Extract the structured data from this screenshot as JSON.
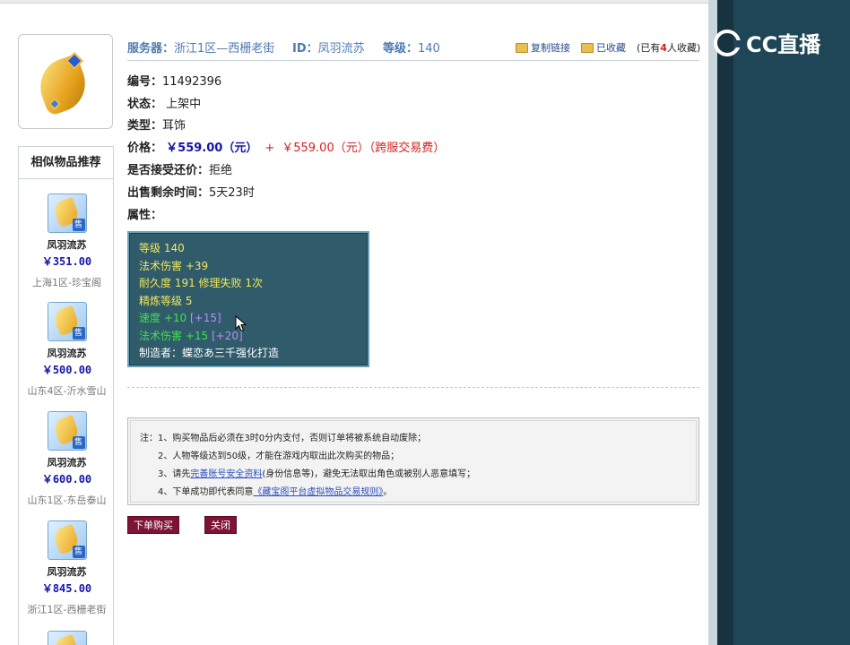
{
  "watermark": {
    "logo_text": "CC直播"
  },
  "header": {
    "server_label": "服务器：",
    "server_value": "浙江1区—西栅老街",
    "id_label": "ID：",
    "id_value": "凤羽流苏",
    "level_label": "等级：",
    "level_value": "140",
    "copy_link": "复制链接",
    "favorited": "已收藏",
    "fav_prefix": "(已有",
    "fav_count": "4",
    "fav_suffix": "人收藏)"
  },
  "item": {
    "number_label": "编号：",
    "number_value": "11492396",
    "status_label": "状态：",
    "status_value": "上架中",
    "type_label": "类型：",
    "type_value": "耳饰",
    "price_label": "价格：",
    "price_value": "￥559.00（元）",
    "price_plus": "+",
    "fee_value": "￥559.00（元）（跨服交易费）",
    "bargain_label": "是否接受还价：",
    "bargain_value": "拒绝",
    "time_label": "出售剩余时间：",
    "time_value": "5天23时",
    "attr_label": "属性："
  },
  "attributes": {
    "line1": "等级 140",
    "line2": "法术伤害 +39",
    "line3": "耐久度 191 修理失败 1次",
    "line4": "精炼等级 5",
    "line5_main": "速度 +10",
    "line5_extra": "[+15]",
    "line6_main": "法术伤害 +15",
    "line6_extra": "[+20]",
    "line7": "制造者：蝶恋あ三千强化打造"
  },
  "sidebar": {
    "title": "相似物品推荐",
    "sell_badge": "售",
    "items": [
      {
        "name": "凤羽流苏",
        "price": "￥351.00",
        "server": "上海1区-珍宝阁"
      },
      {
        "name": "凤羽流苏",
        "price": "￥500.00",
        "server": "山东4区-沂水雪山"
      },
      {
        "name": "凤羽流苏",
        "price": "￥600.00",
        "server": "山东1区-东岳泰山"
      },
      {
        "name": "凤羽流苏",
        "price": "￥845.00",
        "server": "浙江1区-西栅老街"
      }
    ]
  },
  "notes": {
    "line1": "注：1、购买物品后必须在3时0分内支付，否则订单将被系统自动废除；",
    "line2": "2、人物等级达到50级，才能在游戏内取出此次购买的物品；",
    "line3_a": "3、请先",
    "line3_link": "完善账号安全资料",
    "line3_b": "(身份信息等)，避免无法取出角色或被别人恶意填写；",
    "line4_a": "4、下单成功即代表同意",
    "line4_link": "《藏宝阁平台虚拟物品交易规则》",
    "line4_b": "。"
  },
  "buttons": {
    "buy": "下单购买",
    "close": "关闭"
  },
  "colors": {
    "accent_blue": "#4f7ab1",
    "price_blue": "#1515a8",
    "red": "#d42020",
    "button": "#7e1334",
    "attr_bg": "#2f5b6b"
  }
}
